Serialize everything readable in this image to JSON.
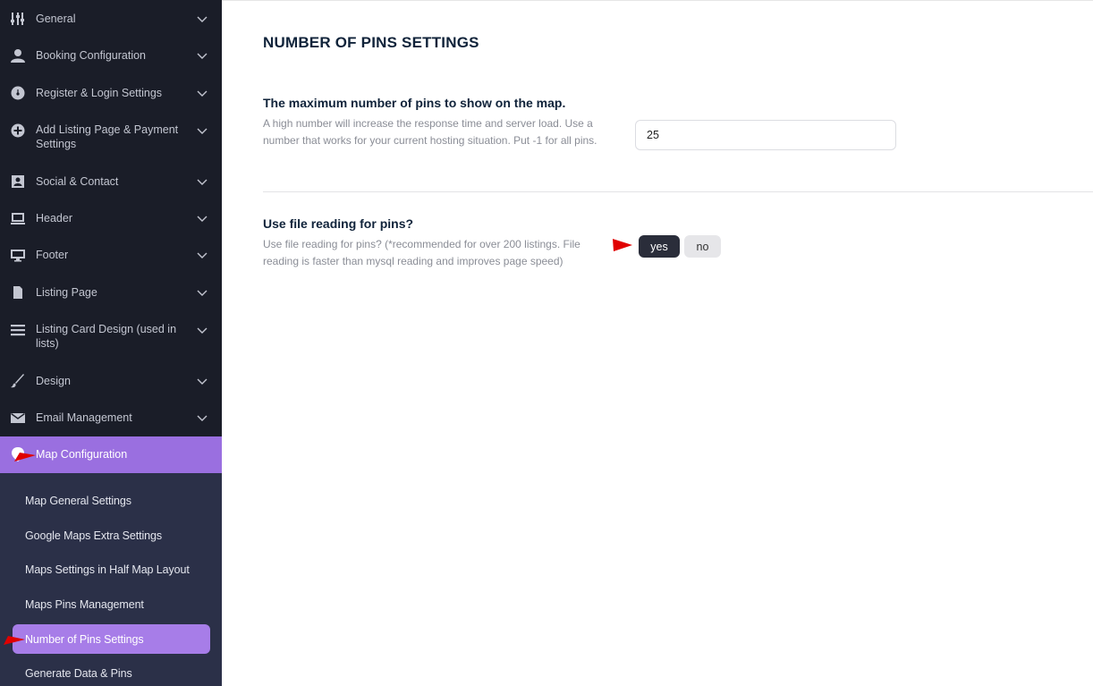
{
  "sidebar": {
    "items": [
      {
        "label": "General",
        "icon": "sliders-icon"
      },
      {
        "label": "Booking Configuration",
        "icon": "user-icon"
      },
      {
        "label": "Register & Login Settings",
        "icon": "tachometer-icon"
      },
      {
        "label": "Add Listing Page & Payment Settings",
        "icon": "plus-circle-icon"
      },
      {
        "label": "Social & Contact",
        "icon": "address-book-icon"
      },
      {
        "label": "Header",
        "icon": "laptop-icon"
      },
      {
        "label": "Footer",
        "icon": "monitor-icon"
      },
      {
        "label": "Listing Page",
        "icon": "file-icon"
      },
      {
        "label": "Listing Card Design (used in lists)",
        "icon": "list-icon"
      },
      {
        "label": "Design",
        "icon": "brush-icon"
      },
      {
        "label": "Email Management",
        "icon": "envelope-icon"
      },
      {
        "label": "Map Configuration",
        "icon": "map-pin-icon"
      }
    ],
    "submenu": [
      {
        "label": "Map General Settings"
      },
      {
        "label": "Google Maps Extra Settings"
      },
      {
        "label": "Maps Settings in Half Map Layout"
      },
      {
        "label": "Maps Pins Management"
      },
      {
        "label": "Number of Pins Settings"
      },
      {
        "label": "Generate Data & Pins"
      }
    ],
    "active_color": "#9a6fe0",
    "submenu_active_color": "#a77de8"
  },
  "main": {
    "title": "NUMBER OF PINS SETTINGS",
    "settings": [
      {
        "title": "The maximum number of pins to show on the map.",
        "description": "A high number will increase the response time and server load. Use a number that works for your current hosting situation. Put -1 for all pins.",
        "value": "25"
      },
      {
        "title": "Use file reading for pins?",
        "description": "Use file reading for pins? (*recommended for over 200 listings. File reading is faster than mysql reading and improves page speed)",
        "options": [
          "yes",
          "no"
        ],
        "selected": "yes"
      }
    ]
  },
  "annotations": {
    "arrow_color": "#e00000"
  }
}
